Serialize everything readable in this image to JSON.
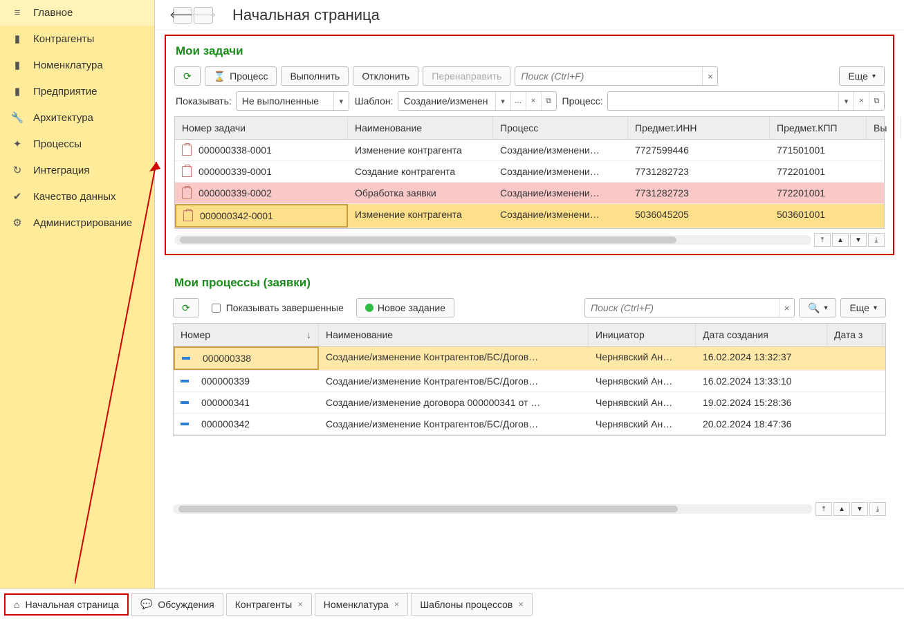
{
  "sidebar": {
    "items": [
      {
        "label": "Главное",
        "icon": "menu"
      },
      {
        "label": "Контрагенты",
        "icon": "book"
      },
      {
        "label": "Номенклатура",
        "icon": "book"
      },
      {
        "label": "Предприятие",
        "icon": "book"
      },
      {
        "label": "Архитектура",
        "icon": "wrench"
      },
      {
        "label": "Процессы",
        "icon": "flow"
      },
      {
        "label": "Интеграция",
        "icon": "sync"
      },
      {
        "label": "Качество данных",
        "icon": "check"
      },
      {
        "label": "Администрирование",
        "icon": "gear"
      }
    ]
  },
  "page_title": "Начальная страница",
  "tasks_panel": {
    "title": "Мои задачи",
    "buttons": {
      "process": "Процесс",
      "execute": "Выполнить",
      "reject": "Отклонить",
      "redirect": "Перенаправить",
      "more": "Еще"
    },
    "search_placeholder": "Поиск (Ctrl+F)",
    "filters": {
      "show_label": "Показывать:",
      "show_value": "Не выполненные",
      "template_label": "Шаблон:",
      "template_value": "Создание/изменен",
      "process_label": "Процесс:",
      "process_value": ""
    },
    "columns": [
      "Номер задачи",
      "Наименование",
      "Процесс",
      "Предмет.ИНН",
      "Предмет.КПП",
      "Вы"
    ],
    "rows": [
      {
        "num": "000000338-0001",
        "name": "Изменение контрагента",
        "proc": "Создание/изменени…",
        "inn": "7727599446",
        "kpp": "771501001",
        "state": ""
      },
      {
        "num": "000000339-0001",
        "name": "Создание контрагента",
        "proc": "Создание/изменени…",
        "inn": "7731282723",
        "kpp": "772201001",
        "state": ""
      },
      {
        "num": "000000339-0002",
        "name": "Обработка заявки",
        "proc": "Создание/изменени…",
        "inn": "7731282723",
        "kpp": "772201001",
        "state": "pink"
      },
      {
        "num": "000000342-0001",
        "name": "Изменение контрагента",
        "proc": "Создание/изменени…",
        "inn": "5036045205",
        "kpp": "503601001",
        "state": "selected"
      }
    ]
  },
  "processes_panel": {
    "title": "Мои процессы (заявки)",
    "show_completed_label": "Показывать завершенные",
    "new_task": "Новое задание",
    "search_placeholder": "Поиск (Ctrl+F)",
    "more": "Еще",
    "columns": [
      "Номер",
      "Наименование",
      "Инициатор",
      "Дата создания",
      "Дата з"
    ],
    "rows": [
      {
        "num": "000000338",
        "name": "Создание/изменение Контрагентов/БС/Догов…",
        "init": "Чернявский Ан…",
        "date": "16.02.2024 13:32:37",
        "state": "selected"
      },
      {
        "num": "000000339",
        "name": "Создание/изменение Контрагентов/БС/Догов…",
        "init": "Чернявский Ан…",
        "date": "16.02.2024 13:33:10",
        "state": ""
      },
      {
        "num": "000000341",
        "name": "Создание/изменение договора 000000341 от …",
        "init": "Чернявский Ан…",
        "date": "19.02.2024 15:28:36",
        "state": ""
      },
      {
        "num": "000000342",
        "name": "Создание/изменение Контрагентов/БС/Догов…",
        "init": "Чернявский Ан…",
        "date": "20.02.2024 18:47:36",
        "state": ""
      }
    ]
  },
  "bottom_tabs": [
    {
      "label": "Начальная страница",
      "closable": false,
      "active": true,
      "icon": "home"
    },
    {
      "label": "Обсуждения",
      "closable": false,
      "icon": "chat"
    },
    {
      "label": "Контрагенты",
      "closable": true
    },
    {
      "label": "Номенклатура",
      "closable": true
    },
    {
      "label": "Шаблоны процессов",
      "closable": true
    }
  ]
}
